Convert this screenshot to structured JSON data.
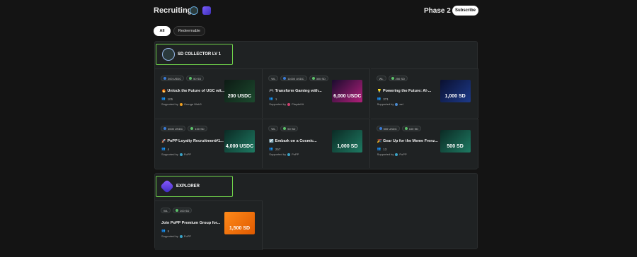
{
  "header": {
    "title": "Recruiting",
    "phase": "Phase 2",
    "subscribe_label": "Subscribe"
  },
  "tabs": [
    {
      "label": "All",
      "active": true
    },
    {
      "label": "Redeemable",
      "active": false
    }
  ],
  "sections": [
    {
      "title": "SD COLLECTOR LV 1",
      "cards": [
        {
          "tags": [
            {
              "text": "200 USDC",
              "icon": "usdc"
            },
            {
              "text": "50 SD",
              "icon": "sd"
            }
          ],
          "emoji": "🔥",
          "title": "Unlock the Future of UGC wit...",
          "participants": "105",
          "supported_by": "Supported by",
          "sponsor": "Orange Web3",
          "sponsor_color": "#f0a020",
          "thumb_text": "200 USDC",
          "thumb_bg": "linear-gradient(135deg,#0d1a14,#1c4a2e)"
        },
        {
          "tags": [
            {
              "text": "WL",
              "icon": ""
            },
            {
              "text": "11000 USDC",
              "icon": "usdc"
            },
            {
              "text": "300 SD",
              "icon": "sd"
            }
          ],
          "emoji": "🎮",
          "title": "Transform Gaming with...",
          "participants": "1",
          "supported_by": "Supported by",
          "sponsor": "PlaydeKit",
          "sponsor_color": "#d04070",
          "thumb_text": "6,000 USDC",
          "thumb_bg": "linear-gradient(135deg,#1a0b2e,#b0207a)"
        },
        {
          "tags": [
            {
              "text": "WL",
              "icon": ""
            },
            {
              "text": "250 SD",
              "icon": "sd"
            }
          ],
          "emoji": "💡",
          "title": "Powering the Future: AI-...",
          "participants": "371",
          "supported_by": "Supported by",
          "sponsor": "ael",
          "sponsor_color": "#4a8ad0",
          "thumb_text": "1,000 SD",
          "thumb_bg": "linear-gradient(135deg,#0a1030,#1d3a8a)"
        },
        {
          "tags": [
            {
              "text": "4000 USDC",
              "icon": "usdc"
            },
            {
              "text": "100 SD",
              "icon": "sd"
            }
          ],
          "emoji": "🚀",
          "title": "PoPP Loyalty Recruitment#1...",
          "participants": "4",
          "supported_by": "Supported by",
          "sponsor": "PoPP",
          "sponsor_color": "#3aa4c8",
          "thumb_text": "4,000 USDC",
          "thumb_bg": "linear-gradient(135deg,#0b2a24,#1e7a62)"
        },
        {
          "tags": [
            {
              "text": "WL",
              "icon": ""
            },
            {
              "text": "50 SD",
              "icon": "sd"
            }
          ],
          "emoji": "☑️",
          "title": "Embark on a Cosmic...",
          "participants": "257",
          "supported_by": "Supported by",
          "sponsor": "PoPP",
          "sponsor_color": "#3aa4c8",
          "thumb_text": "1,000 SD",
          "thumb_bg": "linear-gradient(135deg,#0b2a24,#1e7a62)"
        },
        {
          "tags": [
            {
              "text": "500 USDC",
              "icon": "usdc"
            },
            {
              "text": "100 SD",
              "icon": "sd"
            }
          ],
          "emoji": "🎉",
          "title": "Gear Up for the Meme Frenz...",
          "participants": "13",
          "supported_by": "Supported by",
          "sponsor": "PoPP",
          "sponsor_color": "#3aa4c8",
          "thumb_text": "500 SD",
          "thumb_bg": "linear-gradient(135deg,#0b2a24,#1e7a62)"
        }
      ]
    },
    {
      "title": "EXPLORER",
      "cards": [
        {
          "tags": [
            {
              "text": "WL",
              "icon": ""
            },
            {
              "text": "100 SD",
              "icon": "sd"
            }
          ],
          "emoji": "",
          "title": "Join PoPP Premium Group for...",
          "participants": "5",
          "supported_by": "Supported by",
          "sponsor": "PoPP",
          "sponsor_color": "#3aa4c8",
          "thumb_text": "1,500 SD",
          "thumb_bg": "linear-gradient(135deg,#ff8a1a,#e05a00)"
        }
      ]
    }
  ]
}
